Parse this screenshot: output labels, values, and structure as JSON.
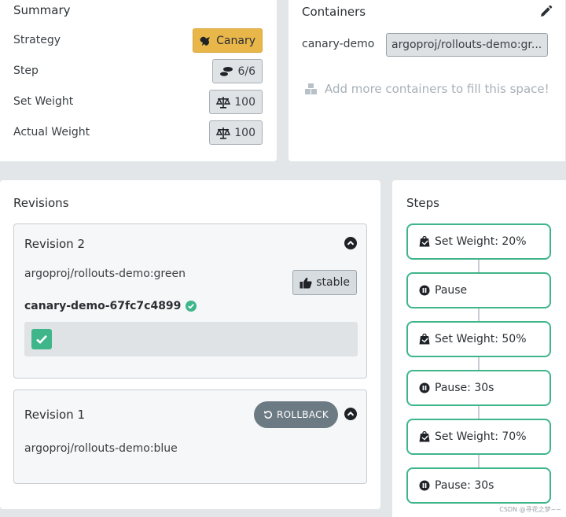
{
  "summary": {
    "title": "Summary",
    "rows": [
      {
        "label": "Strategy",
        "value": "Canary",
        "icon": "canary-bird-icon"
      },
      {
        "label": "Step",
        "value": "6/6",
        "icon": "shoe-prints-icon"
      },
      {
        "label": "Set Weight",
        "value": "100",
        "icon": "balance-scale-icon"
      },
      {
        "label": "Actual Weight",
        "value": "100",
        "icon": "balance-scale-icon"
      }
    ]
  },
  "containers": {
    "title": "Containers",
    "items": [
      {
        "name": "canary-demo",
        "image": "argoproj/rollouts-demo:gr..."
      }
    ],
    "add_more": "Add more containers to fill this space!"
  },
  "revisions": {
    "title": "Revisions",
    "items": [
      {
        "title": "Revision 2",
        "image": "argoproj/rollouts-demo:green",
        "badge": "stable",
        "replicaset": "canary-demo-67fc7c4899",
        "expanded": true
      },
      {
        "title": "Revision 1",
        "image": "argoproj/rollouts-demo:blue",
        "action": "ROLLBACK",
        "expanded": false
      }
    ]
  },
  "steps": {
    "title": "Steps",
    "items": [
      {
        "label": "Set Weight: 20%",
        "icon": "weight-icon"
      },
      {
        "label": "Pause",
        "icon": "pause-icon"
      },
      {
        "label": "Set Weight: 50%",
        "icon": "weight-icon"
      },
      {
        "label": "Pause: 30s",
        "icon": "pause-icon"
      },
      {
        "label": "Set Weight: 70%",
        "icon": "weight-icon"
      },
      {
        "label": "Pause: 30s",
        "icon": "pause-icon"
      }
    ]
  },
  "watermark": "CSDN @寻花之梦~~",
  "colors": {
    "accent_green": "#3fb58a",
    "canary_yellow": "#e9b64a",
    "rollback_gray": "#6c7a83"
  }
}
